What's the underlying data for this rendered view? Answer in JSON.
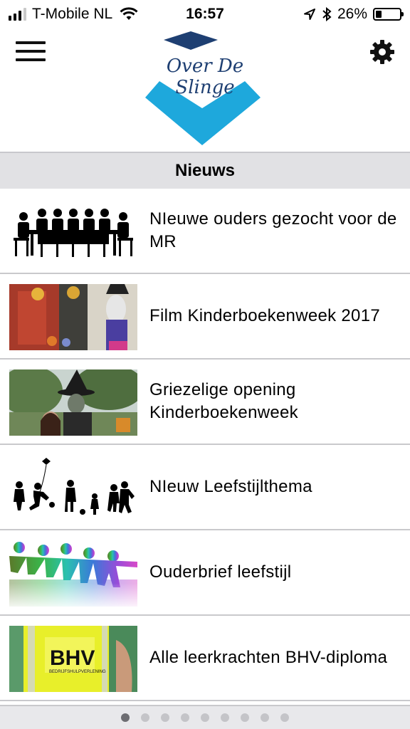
{
  "status_bar": {
    "carrier": "T-Mobile NL",
    "time": "16:57",
    "battery_percent": "26%",
    "battery_level": 0.26,
    "signal_bars_active": 3,
    "icons": [
      "signal-icon",
      "wifi-icon",
      "location-icon",
      "bluetooth-icon",
      "battery-icon"
    ]
  },
  "header": {
    "logo_text": "Over De Slinge",
    "menu_icon": "hamburger-icon",
    "settings_icon": "gear-icon",
    "colors": {
      "logo_navy": "#1e3f72",
      "logo_cyan": "#1ea8dc"
    }
  },
  "section": {
    "title": "Nieuws"
  },
  "news": [
    {
      "title": "NIeuwe ouders gezocht voor de MR",
      "thumb": "meeting-silhouette"
    },
    {
      "title": "Film Kinderboekenweek 2017",
      "thumb": "halloween-photo"
    },
    {
      "title": "Griezelige opening Kinderboekenweek",
      "thumb": "witch-photo"
    },
    {
      "title": "NIeuw Leefstijlthema",
      "thumb": "playing-kids-silhouette"
    },
    {
      "title": "Ouderbrief leefstijl",
      "thumb": "rainbow-paper-people"
    },
    {
      "title": "Alle leerkrachten BHV-diploma",
      "thumb": "bhv-vest-photo"
    }
  ],
  "pager": {
    "pages": 9,
    "active": 1
  }
}
